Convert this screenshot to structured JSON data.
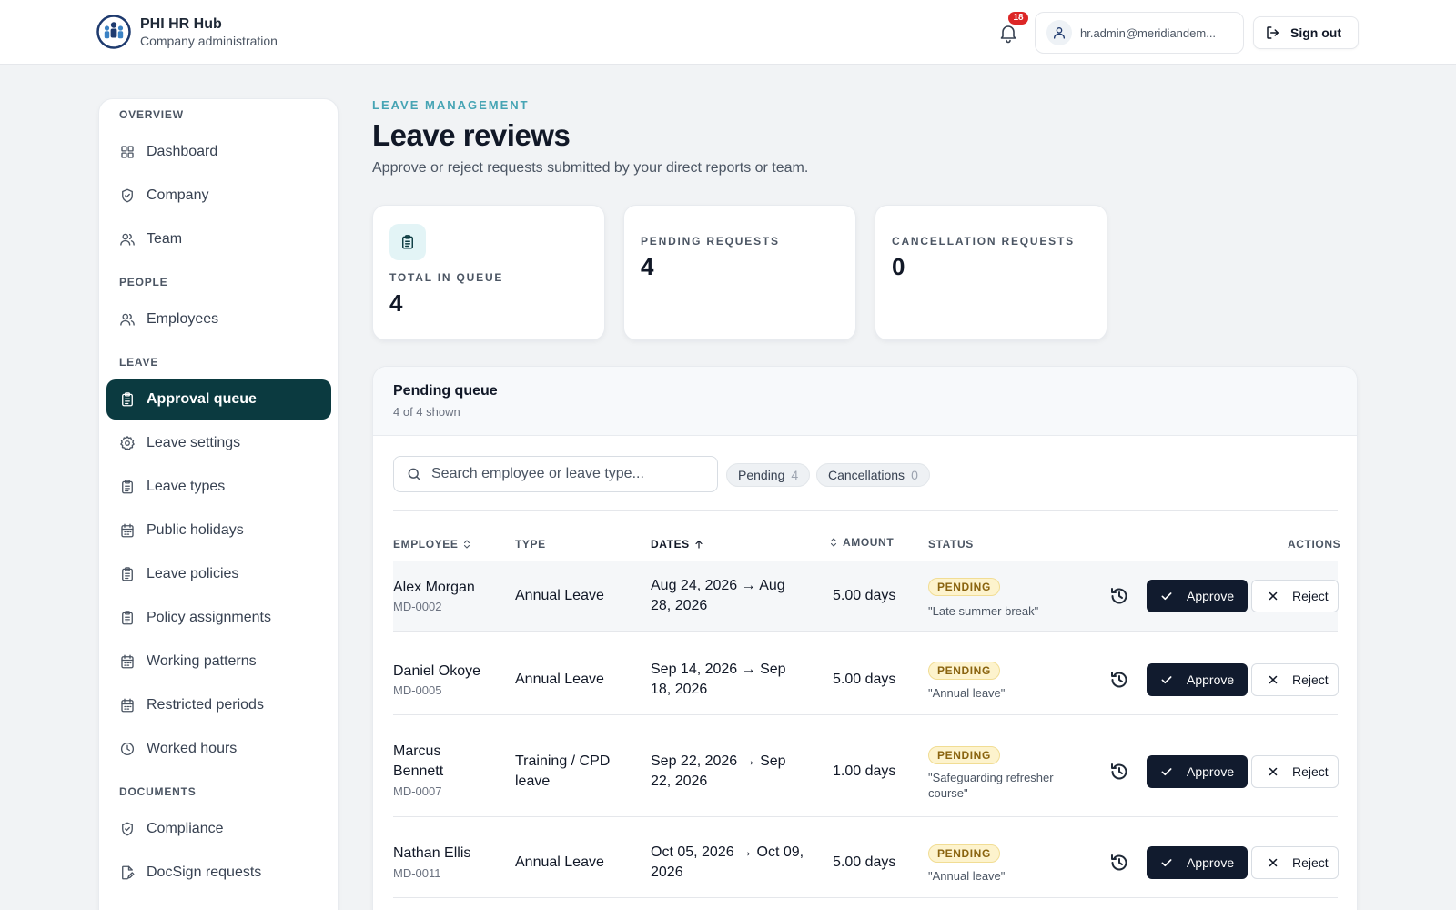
{
  "brand": {
    "title": "PHI HR Hub",
    "subtitle": "Company administration"
  },
  "header": {
    "notifications": "18",
    "user_email": "hr.admin@meridiandem...",
    "sign_out": "Sign out"
  },
  "sidebar": {
    "sections": {
      "overview": "OVERVIEW",
      "people": "PEOPLE",
      "leave": "LEAVE",
      "documents": "DOCUMENTS"
    },
    "items": {
      "dashboard": "Dashboard",
      "company": "Company",
      "team": "Team",
      "employees": "Employees",
      "approval_queue": "Approval queue",
      "leave_settings": "Leave settings",
      "leave_types": "Leave types",
      "public_holidays": "Public holidays",
      "leave_policies": "Leave policies",
      "policy_assignments": "Policy assignments",
      "working_patterns": "Working patterns",
      "restricted_periods": "Restricted periods",
      "worked_hours": "Worked hours",
      "compliance": "Compliance",
      "docsign_requests": "DocSign requests"
    },
    "active": "approval_queue"
  },
  "page": {
    "eyebrow": "LEAVE MANAGEMENT",
    "title": "Leave reviews",
    "subtitle": "Approve or reject requests submitted by your direct reports or team."
  },
  "stats": [
    {
      "label": "TOTAL IN QUEUE",
      "value": "4"
    },
    {
      "label": "PENDING REQUESTS",
      "value": "4"
    },
    {
      "label": "CANCELLATION REQUESTS",
      "value": "0"
    }
  ],
  "queue": {
    "title": "Pending queue",
    "count": "4 of 4 shown",
    "search_placeholder": "Search employee or leave type...",
    "chips": [
      {
        "label": "Pending",
        "count": "4"
      },
      {
        "label": "Cancellations",
        "count": "0"
      }
    ],
    "columns": {
      "employee": "EMPLOYEE",
      "type": "TYPE",
      "dates": "DATES",
      "amount": "AMOUNT",
      "status": "STATUS",
      "actions": "ACTIONS"
    },
    "approve_label": "Approve",
    "reject_label": "Reject",
    "rows": [
      {
        "name": "Alex Morgan",
        "id": "MD-0002",
        "type": "Annual Leave",
        "dates_line1": "Aug 24, 2026 → Aug",
        "dates_line2": "28, 2026",
        "amount": "5.00 days",
        "status": "PENDING",
        "note": "\"Late summer break\""
      },
      {
        "name": "Daniel Okoye",
        "id": "MD-0005",
        "type": "Annual Leave",
        "dates_line1": "Sep 14, 2026 → Sep",
        "dates_line2": "18, 2026",
        "amount": "5.00 days",
        "status": "PENDING",
        "note": "\"Annual leave\""
      },
      {
        "name_line1": "Marcus",
        "name_line2": "Bennett",
        "id": "MD-0007",
        "type_line1": "Training / CPD",
        "type_line2": "leave",
        "dates_line1": "Sep 22, 2026 → Sep",
        "dates_line2": "22, 2026",
        "amount": "1.00 days",
        "status": "PENDING",
        "note_line1": "\"Safeguarding refresher",
        "note_line2": "course\""
      },
      {
        "name": "Nathan Ellis",
        "id": "MD-0011",
        "type": "Annual Leave",
        "dates_line1": "Oct 05, 2026 → Oct 09,",
        "dates_line2": "2026",
        "amount": "5.00 days",
        "status": "PENDING",
        "note": "\"Annual leave\""
      }
    ]
  },
  "colors": {
    "accent": "#46a4b4",
    "active_nav": "#0b3a40",
    "approve_bg": "#111b2e",
    "pending_badge_bg": "#fdf3cd",
    "pending_badge_text": "#8a6410",
    "notification_badge": "#dc2626"
  },
  "icons": {
    "brand": "people-group-logo",
    "notifications": "bell-icon",
    "user": "user-icon",
    "sign_out": "sign-out-icon",
    "search": "search-icon",
    "history": "history-icon",
    "approve": "check-icon",
    "reject": "close-icon"
  }
}
